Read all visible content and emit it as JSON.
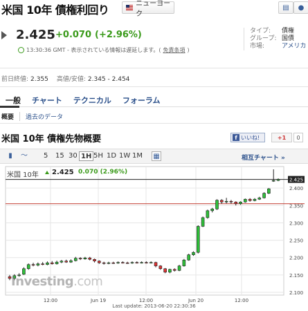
{
  "header": {
    "title": "米国 10年 債権利回り",
    "region_label": "ニューヨーク"
  },
  "quote": {
    "price": "2.425",
    "change": "+0.070",
    "change_pct": "(+2.96%)",
    "time_note": "13:30:36 GMT - 表示されている情報は遅延します。(",
    "disclaimer_link": "免責条項",
    "time_note_end": ")"
  },
  "meta": [
    {
      "key": "タイプ:",
      "value": "債権",
      "link": false
    },
    {
      "key": "グループ:",
      "value": "国債",
      "link": false
    },
    {
      "key": "市場:",
      "value": "アメリカ",
      "link": true
    }
  ],
  "ranges": {
    "prev_close_label": "前日終値:",
    "prev_close": "2.355",
    "high_low_label": "高値/安値:",
    "high_low": "2.345 - 2.454"
  },
  "tabs": [
    "一般",
    "チャート",
    "テクニカル",
    "フォーラム"
  ],
  "subtabs": [
    "概要",
    "過去のデータ"
  ],
  "section_title": "米国 10年 債権先物概要",
  "social": {
    "facebook_label": "いいね!",
    "gplus_label": "+1",
    "gplus_count": "0"
  },
  "toolbar": {
    "timeframes": [
      "5",
      "15",
      "30",
      "1H",
      "5H",
      "1D",
      "1W",
      "1M"
    ],
    "active_timeframe": "1H",
    "mutual_chart": "相互チャート »"
  },
  "chart_inline": {
    "name": "米国 10年",
    "price": "2.425",
    "change": "0.070 (2.96%)"
  },
  "watermark": {
    "brand": "Investing",
    "suffix": ".com"
  },
  "last_update": "Last update: 2013-06-20 22:30:36",
  "colors": {
    "up": "#3a9a1a",
    "down": "#c0392b",
    "link": "#2a4f8a",
    "ref_line": "#c0392b"
  },
  "chart_data": {
    "type": "candlestick",
    "y_ticks": [
      "2.425",
      "2.400",
      "2.350",
      "2.300",
      "2.250",
      "2.200",
      "2.150",
      "2.100"
    ],
    "x_ticks": [
      "12:00",
      "Jun 19",
      "12:00",
      "Jun 20",
      "12:00"
    ],
    "ylim": [
      2.092,
      2.462
    ],
    "last_price": 2.425,
    "reference_line": 2.355,
    "candles": [
      {
        "o": 2.145,
        "c": 2.14,
        "h": 2.15,
        "l": 2.135
      },
      {
        "o": 2.14,
        "c": 2.148,
        "h": 2.152,
        "l": 2.135
      },
      {
        "o": 2.148,
        "c": 2.15,
        "h": 2.155,
        "l": 2.145
      },
      {
        "o": 2.152,
        "c": 2.168,
        "h": 2.172,
        "l": 2.15
      },
      {
        "o": 2.168,
        "c": 2.18,
        "h": 2.183,
        "l": 2.165
      },
      {
        "o": 2.18,
        "c": 2.178,
        "h": 2.185,
        "l": 2.175
      },
      {
        "o": 2.178,
        "c": 2.182,
        "h": 2.186,
        "l": 2.175
      },
      {
        "o": 2.182,
        "c": 2.18,
        "h": 2.187,
        "l": 2.178
      },
      {
        "o": 2.18,
        "c": 2.185,
        "h": 2.189,
        "l": 2.178
      },
      {
        "o": 2.185,
        "c": 2.182,
        "h": 2.19,
        "l": 2.18
      },
      {
        "o": 2.182,
        "c": 2.187,
        "h": 2.191,
        "l": 2.18
      },
      {
        "o": 2.187,
        "c": 2.19,
        "h": 2.193,
        "l": 2.184
      },
      {
        "o": 2.19,
        "c": 2.187,
        "h": 2.194,
        "l": 2.185
      },
      {
        "o": 2.187,
        "c": 2.191,
        "h": 2.195,
        "l": 2.185
      },
      {
        "o": 2.191,
        "c": 2.198,
        "h": 2.202,
        "l": 2.189
      },
      {
        "o": 2.198,
        "c": 2.196,
        "h": 2.201,
        "l": 2.193
      },
      {
        "o": 2.196,
        "c": 2.199,
        "h": 2.202,
        "l": 2.194
      },
      {
        "o": 2.199,
        "c": 2.195,
        "h": 2.202,
        "l": 2.192
      },
      {
        "o": 2.195,
        "c": 2.19,
        "h": 2.197,
        "l": 2.186
      },
      {
        "o": 2.19,
        "c": 2.185,
        "h": 2.192,
        "l": 2.182
      },
      {
        "o": 2.185,
        "c": 2.183,
        "h": 2.188,
        "l": 2.18
      },
      {
        "o": 2.183,
        "c": 2.185,
        "h": 2.188,
        "l": 2.181
      },
      {
        "o": 2.185,
        "c": 2.184,
        "h": 2.188,
        "l": 2.182
      },
      {
        "o": 2.184,
        "c": 2.186,
        "h": 2.189,
        "l": 2.182
      },
      {
        "o": 2.186,
        "c": 2.185,
        "h": 2.189,
        "l": 2.183
      },
      {
        "o": 2.185,
        "c": 2.184,
        "h": 2.188,
        "l": 2.182
      },
      {
        "o": 2.184,
        "c": 2.186,
        "h": 2.189,
        "l": 2.182
      },
      {
        "o": 2.186,
        "c": 2.185,
        "h": 2.189,
        "l": 2.183
      },
      {
        "o": 2.185,
        "c": 2.186,
        "h": 2.189,
        "l": 2.183
      },
      {
        "o": 2.186,
        "c": 2.185,
        "h": 2.189,
        "l": 2.183
      },
      {
        "o": 2.185,
        "c": 2.186,
        "h": 2.189,
        "l": 2.183
      },
      {
        "o": 2.186,
        "c": 2.176,
        "h": 2.188,
        "l": 2.172
      },
      {
        "o": 2.176,
        "c": 2.168,
        "h": 2.178,
        "l": 2.165
      },
      {
        "o": 2.168,
        "c": 2.158,
        "h": 2.17,
        "l": 2.155
      },
      {
        "o": 2.158,
        "c": 2.166,
        "h": 2.168,
        "l": 2.155
      },
      {
        "o": 2.166,
        "c": 2.163,
        "h": 2.169,
        "l": 2.16
      },
      {
        "o": 2.163,
        "c": 2.176,
        "h": 2.179,
        "l": 2.161
      },
      {
        "o": 2.176,
        "c": 2.193,
        "h": 2.196,
        "l": 2.174
      },
      {
        "o": 2.193,
        "c": 2.208,
        "h": 2.211,
        "l": 2.191
      },
      {
        "o": 2.208,
        "c": 2.215,
        "h": 2.218,
        "l": 2.205
      },
      {
        "o": 2.215,
        "c": 2.29,
        "h": 2.293,
        "l": 2.212
      },
      {
        "o": 2.29,
        "c": 2.315,
        "h": 2.318,
        "l": 2.288
      },
      {
        "o": 2.315,
        "c": 2.335,
        "h": 2.338,
        "l": 2.312
      },
      {
        "o": 2.335,
        "c": 2.34,
        "h": 2.343,
        "l": 2.33
      },
      {
        "o": 2.34,
        "c": 2.365,
        "h": 2.368,
        "l": 2.337
      },
      {
        "o": 2.365,
        "c": 2.36,
        "h": 2.368,
        "l": 2.355
      },
      {
        "o": 2.36,
        "c": 2.362,
        "h": 2.372,
        "l": 2.356
      },
      {
        "o": 2.362,
        "c": 2.36,
        "h": 2.366,
        "l": 2.355
      },
      {
        "o": 2.36,
        "c": 2.355,
        "h": 2.362,
        "l": 2.35
      },
      {
        "o": 2.355,
        "c": 2.36,
        "h": 2.362,
        "l": 2.352
      },
      {
        "o": 2.36,
        "c": 2.368,
        "h": 2.37,
        "l": 2.358
      },
      {
        "o": 2.368,
        "c": 2.364,
        "h": 2.371,
        "l": 2.361
      },
      {
        "o": 2.364,
        "c": 2.368,
        "h": 2.371,
        "l": 2.362
      },
      {
        "o": 2.368,
        "c": 2.372,
        "h": 2.375,
        "l": 2.366
      },
      {
        "o": 2.372,
        "c": 2.385,
        "h": 2.388,
        "l": 2.37
      },
      {
        "o": 2.385,
        "c": 2.398,
        "h": 2.4,
        "l": 2.383
      },
      {
        "o": 2.42,
        "c": 2.422,
        "h": 2.454,
        "l": 2.418
      },
      {
        "o": 2.422,
        "c": 2.425,
        "h": 2.428,
        "l": 2.42
      }
    ]
  }
}
